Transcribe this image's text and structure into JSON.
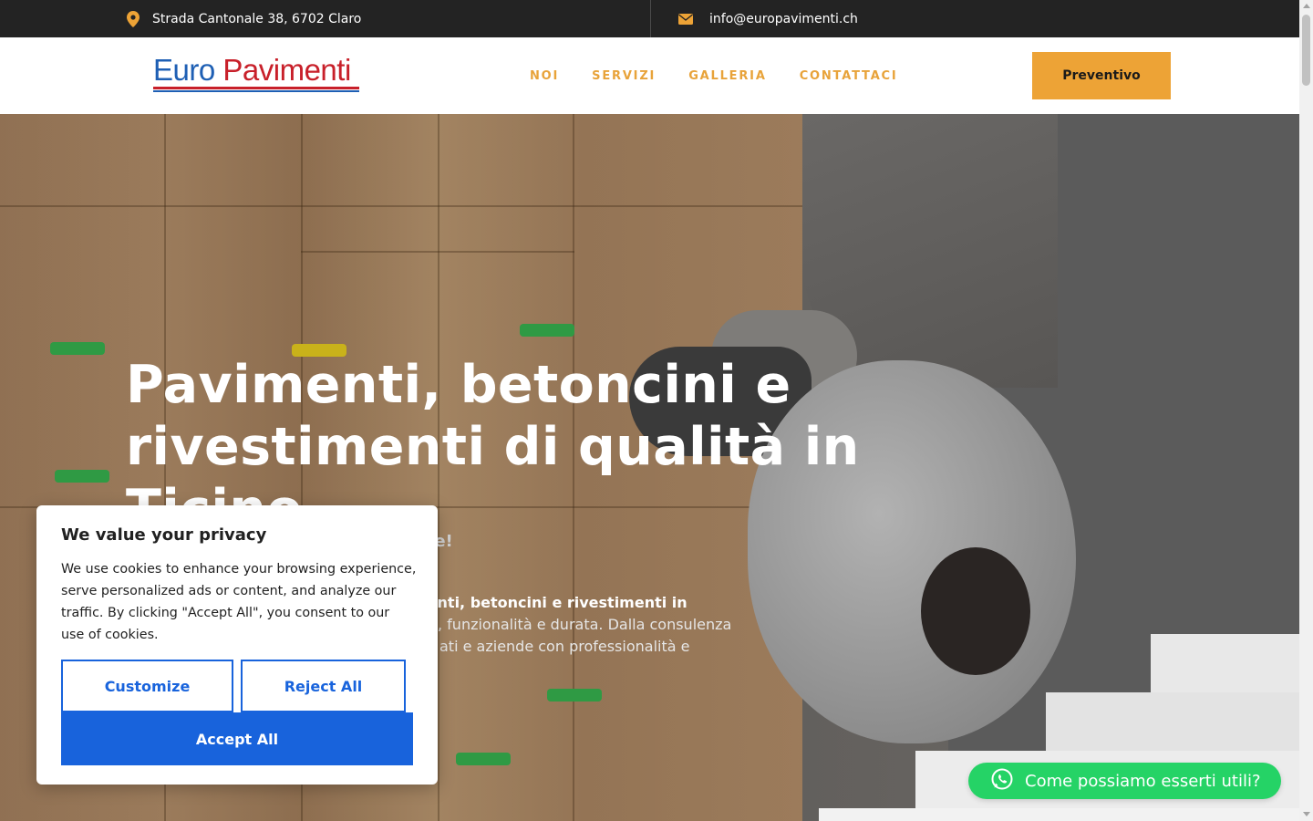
{
  "topbar": {
    "address": "Strada Cantonale 38, 6702 Claro",
    "email": "info@europavimenti.ch",
    "address_icon": "map-pin-icon",
    "email_icon": "envelope-icon"
  },
  "header": {
    "logo_part1": "Euro",
    "logo_part2": "Pavimenti",
    "nav": [
      {
        "label": "NOI"
      },
      {
        "label": "SERVIZI"
      },
      {
        "label": "GALLERIA"
      },
      {
        "label": "CONTATTACI"
      }
    ],
    "cta_label": "Preventivo"
  },
  "hero": {
    "title": "Pavimenti, betoncini e rivestimenti di qualità in Ticino",
    "subtitle_visible": "ale!",
    "text_line1": "menti, betoncini e rivestimenti in",
    "text_line2": ", funzionalità e durata. Dalla consulenza",
    "text_line3": "ati e aziende con professionalità e"
  },
  "cookie": {
    "title": "We value your privacy",
    "body": "We use cookies to enhance your browsing experience, serve personalized ads or content, and analyze our traffic. By clicking \"Accept All\", you consent to our use of cookies.",
    "customize_label": "Customize",
    "reject_label": "Reject All",
    "accept_label": "Accept All"
  },
  "whatsapp": {
    "label": "Come possiamo esserti utili?",
    "icon": "whatsapp-icon"
  },
  "colors": {
    "topbar_bg": "#232323",
    "accent_orange": "#eda336",
    "nav_color": "#e8a33a",
    "cookie_blue": "#1863dc",
    "whatsapp_green": "#25d366",
    "logo_blue": "#1e5fb4",
    "logo_red": "#c8202a"
  }
}
